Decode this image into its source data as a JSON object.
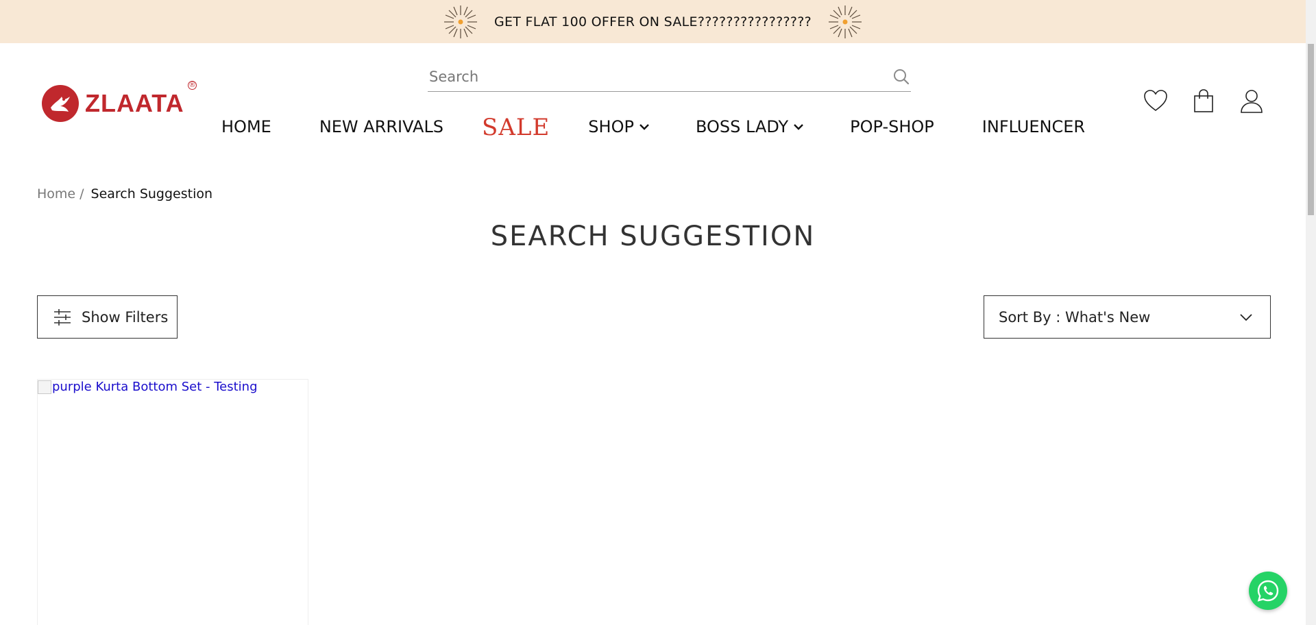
{
  "announcement": {
    "text": "GET FLAT 100 OFFER ON SALE????????????????"
  },
  "logo": {
    "name": "ZLAATA",
    "mark": "®"
  },
  "search": {
    "placeholder": "Search"
  },
  "nav": {
    "items": [
      {
        "label": "HOME",
        "dropdown": false
      },
      {
        "label": "NEW ARRIVALS",
        "dropdown": false
      },
      {
        "label": "SALE",
        "dropdown": false,
        "style": "sale"
      },
      {
        "label": "SHOP",
        "dropdown": true
      },
      {
        "label": "BOSS LADY",
        "dropdown": true
      },
      {
        "label": "POP-SHOP",
        "dropdown": false
      },
      {
        "label": "INFLUENCER",
        "dropdown": false
      }
    ]
  },
  "header_icons": [
    "heart-icon",
    "shopping-bag-icon",
    "user-icon"
  ],
  "breadcrumb": {
    "home": "Home",
    "separator": "/",
    "current": "Search Suggestion"
  },
  "page": {
    "title": "SEARCH SUGGESTION"
  },
  "filters": {
    "label": "Show Filters"
  },
  "sort": {
    "label": "Sort By : What's New"
  },
  "products": [
    {
      "alt": "purple Kurta Bottom Set - Testing"
    }
  ],
  "colors": {
    "announcement_bg": "#f8e8d5",
    "brand_red": "#c0282d",
    "sale_red": "#d23a2c",
    "whatsapp": "#25d366",
    "link_blue": "#1a0dcc"
  }
}
